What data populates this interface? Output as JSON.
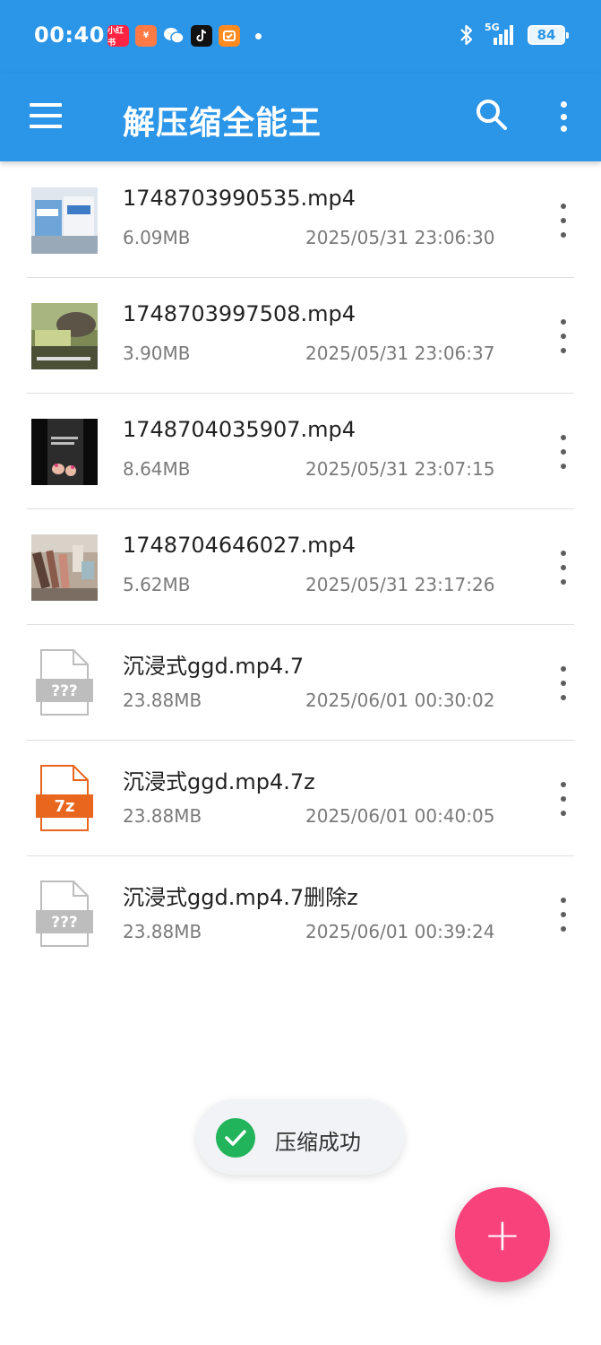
{
  "status_bar": {
    "time": "00:40",
    "network": "5G",
    "battery": "84",
    "notification_icons": [
      "xiaohongshu-icon",
      "taobao-icon",
      "wechat-icon",
      "tiktok-icon",
      "app-icon"
    ]
  },
  "app_bar": {
    "title": "解压缩全能王",
    "color": "#2b95e8"
  },
  "files": [
    {
      "name": "1748703990535.mp4",
      "size": "6.09MB",
      "date": "2025/05/31 23:06:30",
      "icon": "video-thumbnail"
    },
    {
      "name": "1748703997508.mp4",
      "size": "3.90MB",
      "date": "2025/05/31 23:06:37",
      "icon": "video-thumbnail"
    },
    {
      "name": "1748704035907.mp4",
      "size": "8.64MB",
      "date": "2025/05/31 23:07:15",
      "icon": "video-thumbnail"
    },
    {
      "name": "1748704646027.mp4",
      "size": "5.62MB",
      "date": "2025/05/31 23:17:26",
      "icon": "video-thumbnail"
    },
    {
      "name": "沉浸式ggd.mp4.7",
      "size": "23.88MB",
      "date": "2025/06/01 00:30:02",
      "icon": "unknown-file-icon",
      "badge": "???"
    },
    {
      "name": "沉浸式ggd.mp4.7z",
      "size": "23.88MB",
      "date": "2025/06/01 00:40:05",
      "icon": "7z-file-icon",
      "badge": "7z"
    },
    {
      "name": "沉浸式ggd.mp4.7删除z",
      "size": "23.88MB",
      "date": "2025/06/01 00:39:24",
      "icon": "unknown-file-icon",
      "badge": "???"
    }
  ],
  "toast": {
    "text": "压缩成功"
  },
  "fab": {
    "label": "+",
    "color": "#f8427c"
  }
}
